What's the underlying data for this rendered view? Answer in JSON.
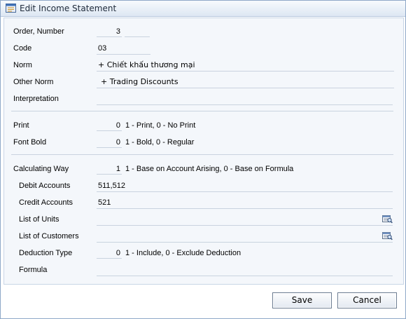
{
  "window": {
    "title": "Edit Income Statement",
    "title_icon": "form-icon"
  },
  "form": {
    "order_number": {
      "label": "Order, Number",
      "value": "3",
      "value2": ""
    },
    "code": {
      "label": "Code",
      "value": "03"
    },
    "norm": {
      "label": "Norm",
      "value": "+ Chiết khấu thương mại"
    },
    "other_norm": {
      "label": "Other Norm",
      "value": "+ Trading Discounts"
    },
    "interpretation": {
      "label": "Interpretation",
      "value": ""
    },
    "print": {
      "label": "Print",
      "value": "0",
      "hint": "1 - Print, 0 - No Print"
    },
    "font_bold": {
      "label": "Font Bold",
      "value": "0",
      "hint": "1 - Bold, 0 - Regular"
    },
    "calculating_way": {
      "label": "Calculating Way",
      "value": "1",
      "hint": "1 - Base on Account Arising, 0 - Base on Formula"
    },
    "debit_accounts": {
      "label": "Debit Accounts",
      "value": "511,512"
    },
    "credit_accounts": {
      "label": "Credit Accounts",
      "value": "521"
    },
    "list_of_units": {
      "label": "List of Units",
      "value": "",
      "icon": "browse-list-icon"
    },
    "list_of_customers": {
      "label": "List of Customers",
      "value": "",
      "icon": "browse-list-icon"
    },
    "deduction_type": {
      "label": "Deduction Type",
      "value": "0",
      "hint": "1 - Include, 0 - Exclude Deduction"
    },
    "formula": {
      "label": "Formula",
      "value": ""
    }
  },
  "buttons": {
    "save": "Save",
    "cancel": "Cancel"
  }
}
